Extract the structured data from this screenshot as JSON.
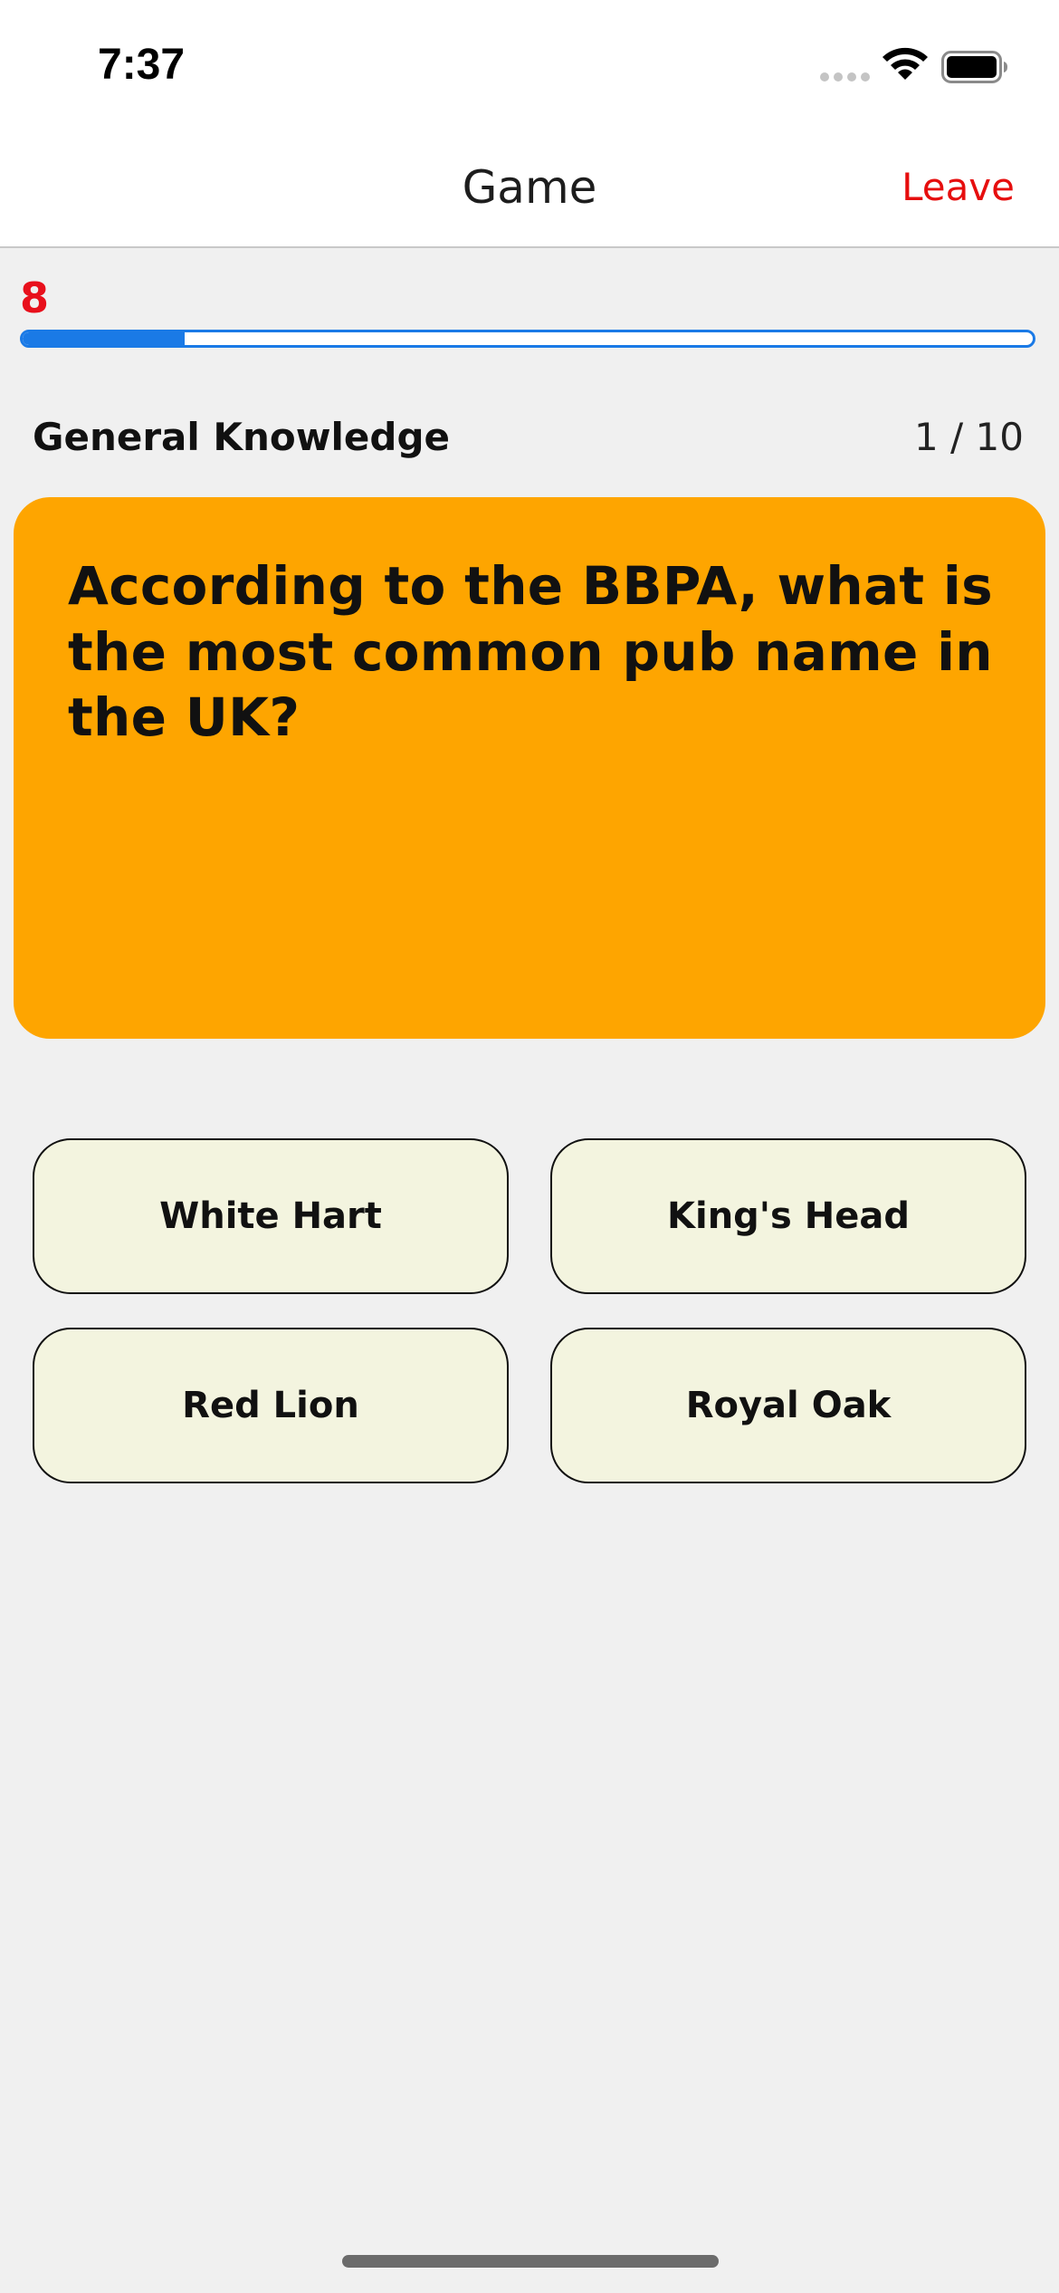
{
  "status_bar": {
    "time": "7:37",
    "icons": [
      "cellular-signal-icon",
      "wifi-icon",
      "battery-icon"
    ]
  },
  "nav": {
    "title": "Game",
    "leave_label": "Leave"
  },
  "timer": {
    "value": "8",
    "color": "#e8101c",
    "progress_fraction": 0.16,
    "progress_color": "#1a7ae6"
  },
  "question": {
    "category": "General Knowledge",
    "counter": "1 / 10",
    "text": "According to the BBPA, what is the most common pub name in the UK?",
    "card_color": "#fea500"
  },
  "answers": [
    {
      "label": "White Hart"
    },
    {
      "label": "King's Head"
    },
    {
      "label": "Red Lion"
    },
    {
      "label": "Royal Oak"
    }
  ]
}
